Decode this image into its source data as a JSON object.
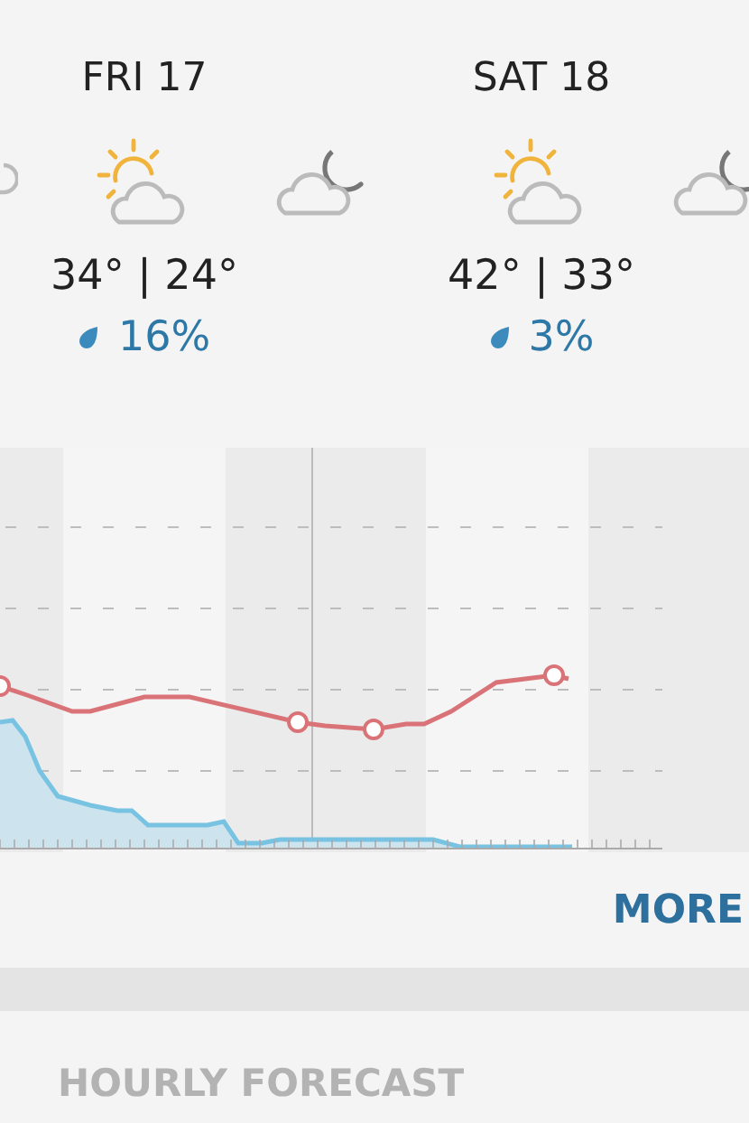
{
  "days": [
    {
      "label": "FRI 17",
      "temps": "34° | 24°",
      "precip": "16%"
    },
    {
      "label": "SAT 18",
      "temps": "42° | 33°",
      "precip": "3%"
    }
  ],
  "more_button": "MORE",
  "section_title": "HOURLY FORECAST"
}
